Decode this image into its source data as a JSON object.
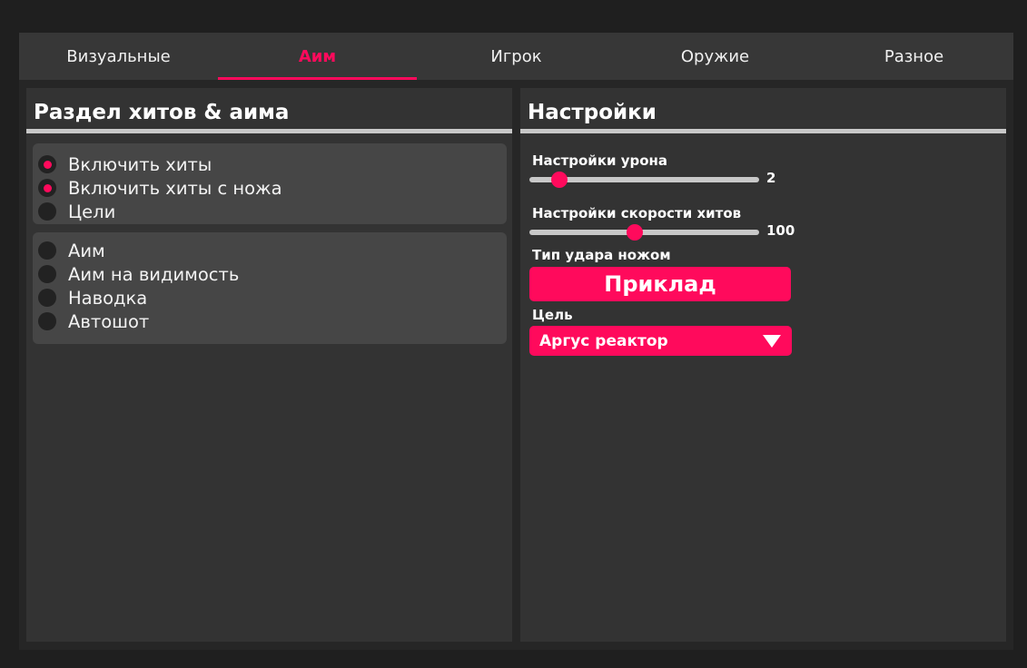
{
  "tabs": [
    {
      "label": "Визуальные",
      "active": false
    },
    {
      "label": "Аим",
      "active": true
    },
    {
      "label": "Игрок",
      "active": false
    },
    {
      "label": "Оружие",
      "active": false
    },
    {
      "label": "Разное",
      "active": false
    }
  ],
  "left_panel": {
    "title": "Раздел хитов & аима",
    "group1": [
      {
        "label": "Включить хиты",
        "checked": true
      },
      {
        "label": "Включить хиты с ножа",
        "checked": true
      },
      {
        "label": "Цели",
        "checked": false
      }
    ],
    "group2": [
      {
        "label": "Аим",
        "checked": false
      },
      {
        "label": "Аим на видимость",
        "checked": false
      },
      {
        "label": "Наводка",
        "checked": false
      },
      {
        "label": "Автошот",
        "checked": false
      }
    ]
  },
  "right_panel": {
    "title": "Настройки",
    "damage": {
      "label": "Настройки урона",
      "value": "2",
      "fraction": 0.13
    },
    "hit_speed": {
      "label": "Настройки скорости хитов",
      "value": "100",
      "fraction": 0.46
    },
    "knife_type": {
      "label": "Тип удара ножом",
      "button": "Приклад"
    },
    "target": {
      "label": "Цель",
      "selected": "Аргус реактор"
    }
  },
  "colors": {
    "accent": "#ff0a5c",
    "background": "#1f1f1f",
    "panel": "#333333",
    "group": "#464646"
  }
}
